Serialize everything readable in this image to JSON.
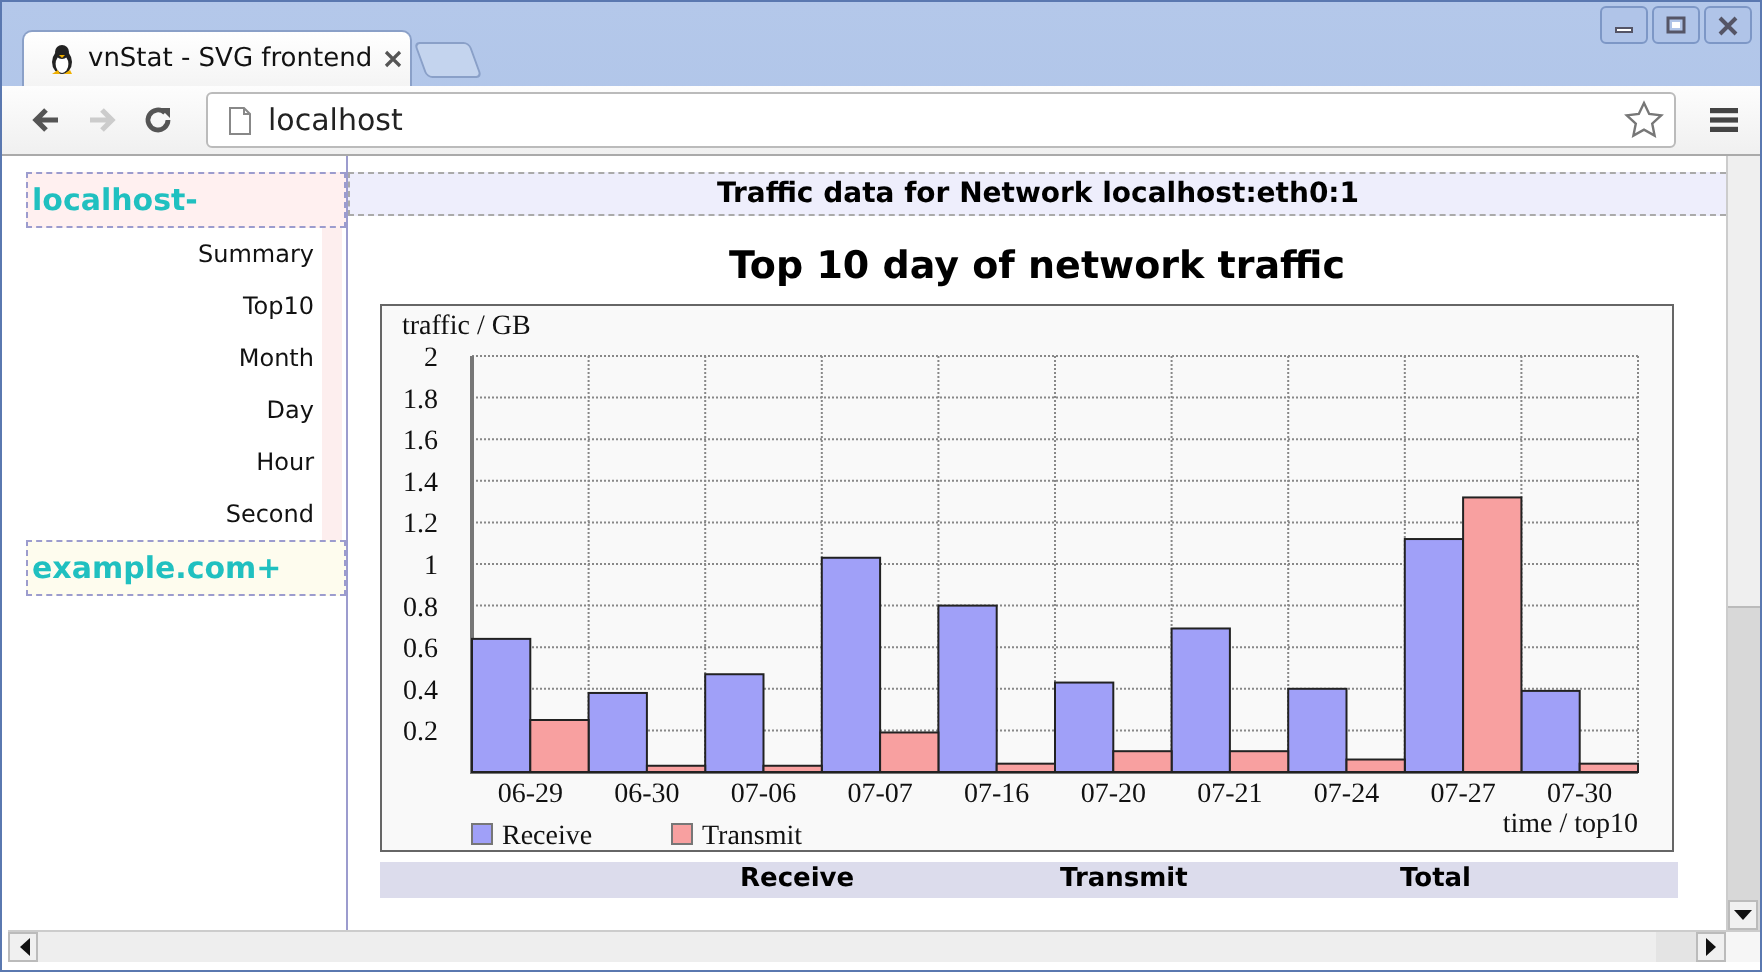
{
  "browser": {
    "tabs": [
      {
        "title": "vnStat - SVG frontend",
        "selected": true
      }
    ],
    "address": "localhost"
  },
  "sidebar": {
    "hosts": [
      {
        "label": "localhost-",
        "expanded": true,
        "items": [
          "Summary",
          "Top10",
          "Month",
          "Day",
          "Hour",
          "Second"
        ]
      },
      {
        "label": "example.com+",
        "expanded": false
      }
    ]
  },
  "main": {
    "header": "Traffic data for Network localhost:eth0:1",
    "title": "Top 10 day of network traffic",
    "chart_data": {
      "type": "bar",
      "ylabel": "traffic / GB",
      "xlabel": "time / top10",
      "categories": [
        "06-29",
        "06-30",
        "07-06",
        "07-07",
        "07-16",
        "07-20",
        "07-21",
        "07-24",
        "07-27",
        "07-30"
      ],
      "series": [
        {
          "name": "Receive",
          "color": "#a0a0f8",
          "values": [
            0.64,
            0.38,
            0.47,
            1.03,
            0.8,
            0.43,
            0.69,
            0.4,
            1.12,
            0.39
          ]
        },
        {
          "name": "Transmit",
          "color": "#f8a0a0",
          "values": [
            0.25,
            0.03,
            0.03,
            0.19,
            0.04,
            0.1,
            0.1,
            0.06,
            1.32,
            0.04
          ]
        }
      ],
      "grid": true,
      "legend": "bottom-left",
      "ylim": [
        0,
        2
      ],
      "yticks": [
        0.2,
        0.4,
        0.6,
        0.8,
        1,
        1.2,
        1.4,
        1.6,
        1.8,
        2
      ]
    },
    "table": {
      "columns": [
        "Receive",
        "Transmit",
        "Total"
      ]
    }
  }
}
